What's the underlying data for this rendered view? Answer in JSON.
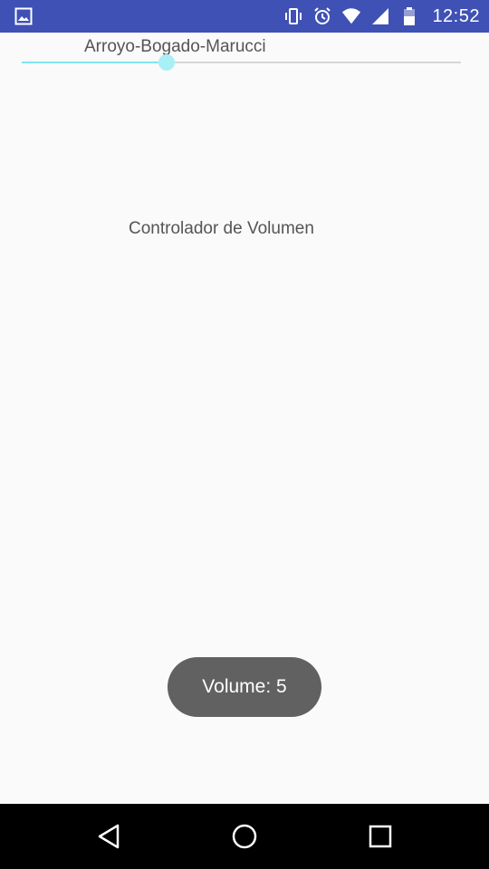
{
  "status_bar": {
    "time": "12:52",
    "icons": [
      "gallery-icon",
      "vibrate-icon",
      "alarm-icon",
      "wifi-icon",
      "signal-icon",
      "battery-icon"
    ]
  },
  "app": {
    "title": "Arroyo-Bogado-Marucci",
    "center_label": "Controlador de Volumen"
  },
  "volume_slider": {
    "value_fraction": 0.33
  },
  "toast": {
    "text": "Volume: 5"
  },
  "nav_bar": {
    "icons": [
      "back-icon",
      "home-icon",
      "recent-apps-icon"
    ]
  },
  "colors": {
    "status_bar": "#3f51b5",
    "slider_accent": "#80e5f0",
    "toast_background": "#616161"
  }
}
